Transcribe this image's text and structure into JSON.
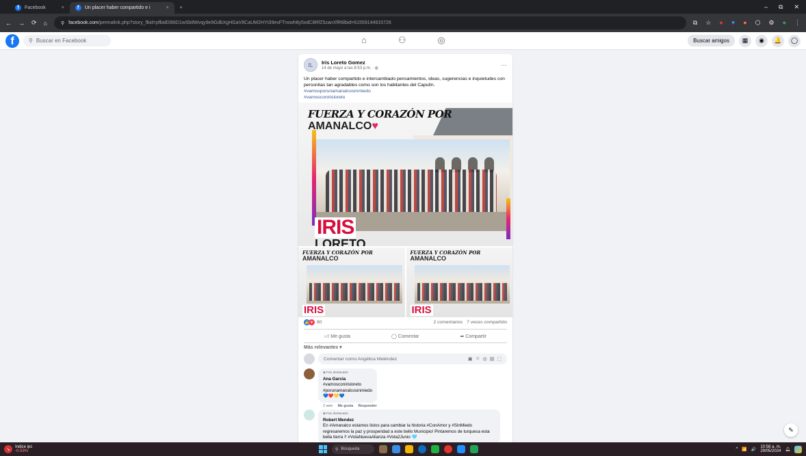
{
  "browser": {
    "tabs": [
      {
        "title": "Facebook",
        "active": false,
        "close": "×"
      },
      {
        "title": "Un placer haber compartido e i",
        "active": true,
        "close": "×"
      }
    ],
    "new_tab": "+",
    "url_host": "facebook.com",
    "url_rest": "/permalink.php?story_fbid=pfbid036tD1wSb8Wvqy9e9GdbXgHGaV8CaUM2HYt39esFTnswh8y5xdC8RfZ5zanXfR6lbid=61559144915726",
    "window_controls": [
      "–",
      "⧉",
      "✕"
    ],
    "nav_icons": [
      "←",
      "→",
      "⟳",
      "⌂"
    ],
    "ext_icons": [
      "⧉",
      "☆",
      "●",
      "♥",
      "●",
      "⬡",
      "⚙",
      "●",
      "⋮"
    ]
  },
  "facebook": {
    "logo": "f",
    "search_placeholder": "Buscar en Facebook",
    "nav_icons": [
      "⌂",
      "⚇",
      "◎"
    ],
    "find_friends": "Buscar amigos",
    "right_icons": [
      "▦",
      "◉",
      "🔔",
      "◯"
    ]
  },
  "post": {
    "author": "Iris Loreto Gomez",
    "avatar": "IL",
    "date": "14 de mayo a las 8:53 p.m. · ",
    "privacy_icon": "globe-icon",
    "more": "···",
    "text": "Un placer haber compartido e intercambiado pensamientos, ideas, sugerencias e inquietudes con personitas tan agradables como son los habitantes del Capulín.",
    "hashtags": [
      "#vamosporunamanalcosinmiedo",
      "#vamosconirisloreto"
    ],
    "image": {
      "headline": "FUERZA Y CORAZÓN POR",
      "town": "AMANALCO",
      "name": "IRIS",
      "surname": "LORETO"
    },
    "reaction_count": "80",
    "comments_count": "2 comentarios",
    "shares_count": "7 veces compartido",
    "actions": {
      "like": "Me gusta",
      "comment": "Comentar",
      "share": "Compartir"
    },
    "sort_label": "Más relevantes",
    "comment_placeholder": "Comentar como Angélica Meléndez",
    "comment_tools": [
      "▣",
      "☺",
      "◎",
      "▤",
      "⬚"
    ],
    "comments": [
      {
        "badge": "Fan destacado",
        "author": "Ana Garcia",
        "lines": [
          "#vamosconirisloreto",
          "#porunamanalcosinmiedo"
        ],
        "emoji": "💙❤️💛💙",
        "time": "2 sem",
        "like": "Me gusta",
        "reply": "Responder"
      },
      {
        "badge": "Fan destacado",
        "author": "Robert Mendez",
        "text": "En #Amanalco estamos listos para cambiar la historia #ConAmor y #SinMiedo regresaremos la paz y prosperidad a este bello Municipio! Pintaremos de turquesa esta bella tierra !! #VotaNuevaAlianza #Vota2Junio 🩵"
      }
    ]
  },
  "floating": {
    "edit_icon": "✎"
  },
  "taskbar": {
    "stock_name": "Indice ipc",
    "stock_change": "-0.53%",
    "search": "Búsqueda",
    "time": "10:58 a. m.",
    "date": "29/05/2024",
    "tray": [
      "^",
      "📶",
      "🔊"
    ],
    "app_colors": [
      "#8a6d4a",
      "#3a8ee6",
      "#f2b705",
      "#0f6cbd",
      "#1fb141",
      "#e3342f",
      "#1e90ff",
      "#22a35a"
    ]
  },
  "colors": {
    "brand": "#1877f2",
    "link": "#385898",
    "accent_red": "#d90d3d"
  }
}
